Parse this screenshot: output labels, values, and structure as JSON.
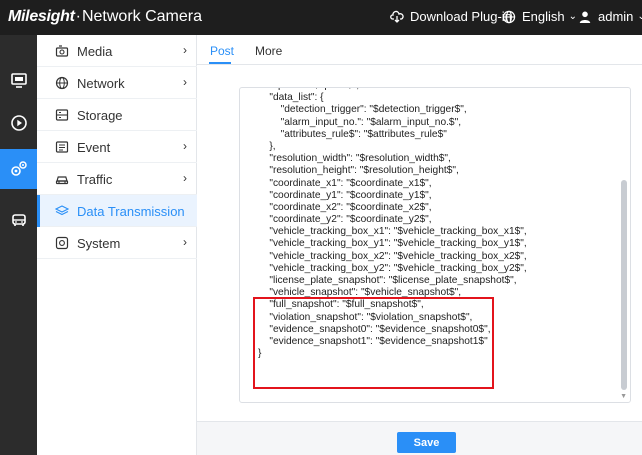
{
  "header": {
    "brand_logo": "Milesight",
    "brand_sep": "·",
    "brand_product": "Network Camera",
    "download_label": "Download Plug-in",
    "language_label": "English",
    "user_label": "admin"
  },
  "rail": {
    "items": [
      {
        "icon": "live-view-icon"
      },
      {
        "icon": "playback-icon"
      },
      {
        "icon": "settings-gears-icon",
        "active": true
      },
      {
        "icon": "vehicle-icon"
      }
    ]
  },
  "subnav": {
    "items": [
      {
        "label": "Media",
        "icon": "media-icon",
        "chevron": "›"
      },
      {
        "label": "Network",
        "icon": "globe-icon",
        "chevron": "›"
      },
      {
        "label": "Storage",
        "icon": "storage-icon",
        "chevron": ""
      },
      {
        "label": "Event",
        "icon": "event-icon",
        "chevron": "›"
      },
      {
        "label": "Traffic",
        "icon": "car-icon",
        "chevron": "›"
      },
      {
        "label": "Data Transmission",
        "icon": "layers-icon",
        "chevron": "",
        "active": true
      },
      {
        "label": "System",
        "icon": "system-icon",
        "chevron": "›"
      }
    ]
  },
  "tabs": [
    {
      "label": "Post",
      "active": true
    },
    {
      "label": "More"
    }
  ],
  "editor": {
    "lines": [
      "    \"speed\": \"$speed$\",",
      "    \"data_list\": {",
      "        \"detection_trigger\": \"$detection_trigger$\",",
      "        \"alarm_input_no.\": \"$alarm_input_no.$\",",
      "        \"attributes_rule$\": \"$attributes_rule$\"",
      "    },",
      "    \"resolution_width\": \"$resolution_width$\",",
      "    \"resolution_height\": \"$resolution_height$\",",
      "    \"coordinate_x1\": \"$coordinate_x1$\",",
      "    \"coordinate_y1\": \"$coordinate_y1$\",",
      "    \"coordinate_x2\": \"$coordinate_x2$\",",
      "    \"coordinate_y2\": \"$coordinate_y2$\",",
      "    \"vehicle_tracking_box_x1\": \"$vehicle_tracking_box_x1$\",",
      "    \"vehicle_tracking_box_y1\": \"$vehicle_tracking_box_y1$\",",
      "    \"vehicle_tracking_box_x2\": \"$vehicle_tracking_box_x2$\",",
      "    \"vehicle_tracking_box_y2\": \"$vehicle_tracking_box_y2$\",",
      "    \"license_plate_snapshot\": \"$license_plate_snapshot$\",",
      "    \"vehicle_snapshot\": \"$vehicle_snapshot$\",",
      "    \"full_snapshot\": \"$full_snapshot$\",",
      "    \"violation_snapshot\": \"$violation_snapshot$\",",
      "    \"evidence_snapshot0\": \"$evidence_snapshot0$\",",
      "    \"evidence_snapshot1\": \"$evidence_snapshot1$\"",
      "}"
    ]
  },
  "footer": {
    "save_label": "Save"
  },
  "colors": {
    "accent": "#2a8ff7",
    "highlight": "#e3141c",
    "header_bg": "#1e1e1e",
    "rail_bg": "#2c2c2c"
  }
}
